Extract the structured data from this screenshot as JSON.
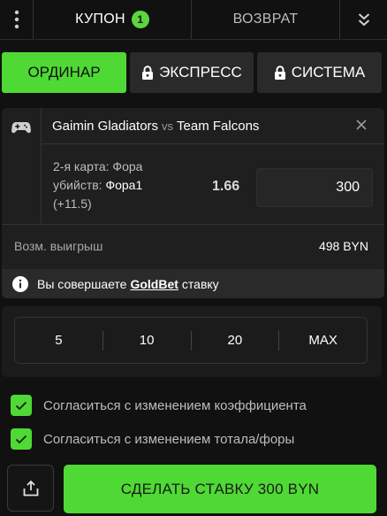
{
  "tabs": {
    "kupon_label": "КУПОН",
    "kupon_count": "1",
    "return_label": "ВОЗВРАТ"
  },
  "bet_types": {
    "single": "ОРДИНАР",
    "express": "ЭКСПРЕСС",
    "system": "СИСТЕМА"
  },
  "bet": {
    "team1": "Gaimin Gladiators",
    "vs": "vs",
    "team2": "Team Falcons",
    "market_prefix": "2-я карта: Фора убийств:",
    "pick": "Фора1",
    "handicap": "(+11.5)",
    "odds": "1.66",
    "stake": "300",
    "possible_win_label": "Возм. выигрыш",
    "possible_win_value": "498 BYN"
  },
  "info": {
    "before": "Вы совершаете",
    "brand": "GoldBet",
    "after": "ставку"
  },
  "quick_amounts": [
    "5",
    "10",
    "20",
    "MAX"
  ],
  "checkboxes": [
    {
      "label": "Согласиться с изменением коэффициента",
      "checked": true
    },
    {
      "label": "Согласиться с изменением тотала/форы",
      "checked": true
    }
  ],
  "actions": {
    "place_bet": "СДЕЛАТЬ СТАВКУ 300 BYN"
  },
  "icons": {
    "menu": "kebab-icon",
    "collapse": "chevrons-down-icon",
    "lock": "lock-icon",
    "game": "gamepad-icon",
    "close": "close-icon",
    "info": "info-icon",
    "check": "check-icon",
    "share": "share-icon"
  },
  "colors": {
    "accent": "#4fd934",
    "background": "#111111",
    "card": "#1f1f1f"
  }
}
